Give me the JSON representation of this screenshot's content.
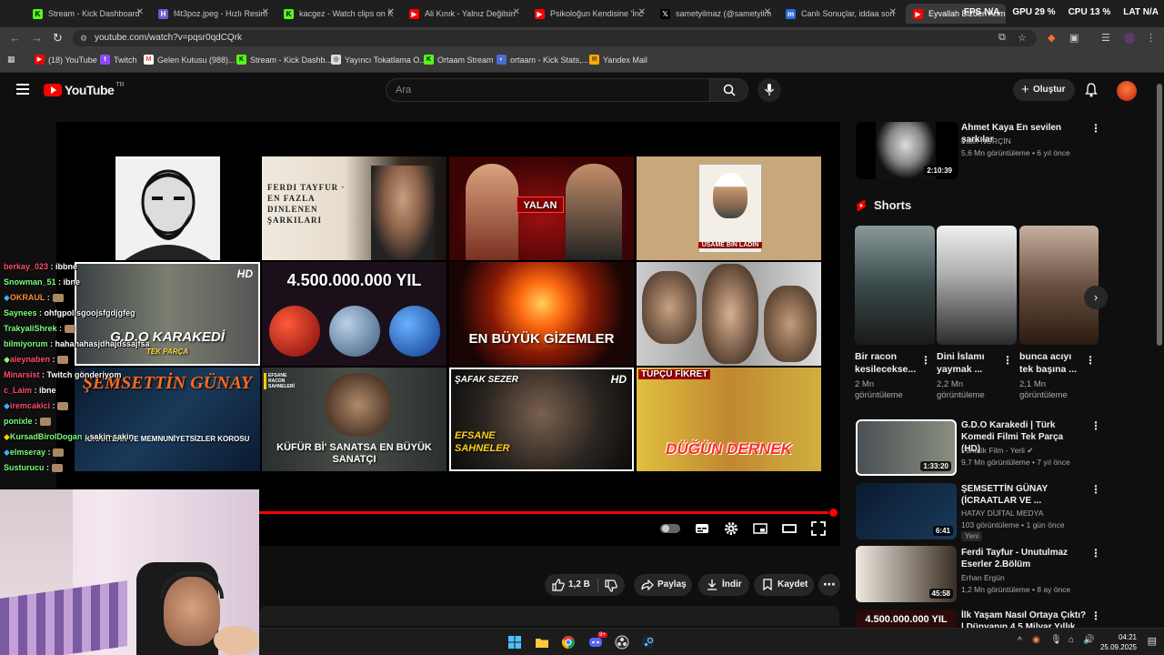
{
  "browser": {
    "tabs": [
      {
        "label": "Stream - Kick Dashboard",
        "color": "#53fc18"
      },
      {
        "label": "f4t3poz.jpeg - Hızlı Resim",
        "color": "#6b5bd2"
      },
      {
        "label": "kacgez - Watch clips on K",
        "color": "#53fc18"
      },
      {
        "label": "Ali Kınık - Yalnız Değilsin",
        "color": "#ff0000"
      },
      {
        "label": "Psikoloğun Kendisine 'İnc",
        "color": "#ff0000"
      },
      {
        "label": "sametyilmaz (@sametyilm",
        "color": "#ffffff"
      },
      {
        "label": "Canlı Sonuçlar, iddaa son",
        "color": "#2d6cdf"
      },
      {
        "label": "Eyvallah Bizden Ahm",
        "color": "#ff0000"
      }
    ],
    "perf": {
      "fps_label": "FPS",
      "fps": "N/A",
      "gpu_label": "GPU",
      "gpu": "29 %",
      "cpu_label": "CPU",
      "cpu": "13 %",
      "lat_label": "LAT",
      "lat": "N/A"
    },
    "url": "youtube.com/watch?v=pqsr0qdCQrk",
    "bookmarks": [
      {
        "label": "(18) YouTube",
        "color": "#ff0000"
      },
      {
        "label": "Twitch",
        "color": "#9146ff"
      },
      {
        "label": "Gelen Kutusu (988)...",
        "color": "#ea4335"
      },
      {
        "label": "Stream - Kick Dashb...",
        "color": "#53fc18"
      },
      {
        "label": "Yayıncı Tokatlama O...",
        "color": "#dddddd"
      },
      {
        "label": "Ortaam Stream",
        "color": "#53fc18"
      },
      {
        "label": "ortaam - Kick Stats,...",
        "color": "#4a6cd4"
      },
      {
        "label": "Yandex Mail",
        "color": "#ffaa00"
      }
    ]
  },
  "youtube": {
    "logo": "YouTube",
    "logo_country": "TR",
    "search_placeholder": "Ara",
    "create_label": "Oluştur",
    "accent": "#ff0000"
  },
  "player": {
    "end_screen": [
      {
        "id": "ahmet",
        "caption": ""
      },
      {
        "id": "ferdi",
        "caption": "FERDI TAYFUR · EN FAZLA DINLENEN ŞARKILARI"
      },
      {
        "id": "yalan",
        "caption": "YALAN"
      },
      {
        "id": "usame",
        "caption": "USAME BIN LADIN"
      },
      {
        "id": "gdo",
        "caption": "G.D.O KARAKEDİ",
        "sub": "TEK PARÇA",
        "hd": "HD"
      },
      {
        "id": "yil",
        "caption": "4.500.000.000 YIL"
      },
      {
        "id": "gizem",
        "caption": "EN BÜYÜK GİZEMLER"
      },
      {
        "id": "ferdi2",
        "caption": ""
      },
      {
        "id": "semsettin",
        "caption": "ŞEMSETTİN GÜNAY",
        "sub": "İCRAATLAR VE MEMNUNİYETSİZLER KOROSU"
      },
      {
        "id": "kufur",
        "caption": "KÜFÜR Bİ' SANATSA EN BÜYÜK SANATÇI",
        "badge": "EFSANE RACON SAHNELERİ"
      },
      {
        "id": "safak",
        "caption": "EFSANE SAHNELER",
        "top": "ŞAFAK SEZER",
        "hd": "HD"
      },
      {
        "id": "dugun",
        "caption": "DÜĞÜN DERNEK",
        "top": "TÜPÇÜ FİKRET"
      }
    ],
    "progress_played": 0.99
  },
  "actions": {
    "likes": "1,2 B",
    "share": "Paylaş",
    "download": "İndir",
    "save": "Kaydet"
  },
  "chat": [
    {
      "user": "berkay_023",
      "msg": "ibbne",
      "color": "#ff4d6d"
    },
    {
      "user": "Snowman_51",
      "msg": "ibne",
      "color": "#7dff7d"
    },
    {
      "user": "OKRAUL",
      "msg": "",
      "color": "#ff8c3a"
    },
    {
      "user": "Saynees",
      "msg": "ohfgpollsgoojsfgdjgfeg",
      "color": "#7dff7d"
    },
    {
      "user": "TrakyaliShrek",
      "msg": "",
      "color": "#7dff7d"
    },
    {
      "user": "bilmiyorum",
      "msg": "hahahahasjdhajdssajfsa",
      "color": "#7dff7d"
    },
    {
      "user": "aleynaben",
      "msg": "",
      "color": "#ff4d6d"
    },
    {
      "user": "Minarsist",
      "msg": "Twitch gönderiyom",
      "color": "#ff4d6d"
    },
    {
      "user": "c_Laim",
      "msg": "ibne",
      "color": "#ff4d6d"
    },
    {
      "user": "iremcakici",
      "msg": "",
      "color": "#ff4d6d"
    },
    {
      "user": "ponixle",
      "msg": "",
      "color": "#7dff7d"
    },
    {
      "user": "KursadBirolDogan",
      "msg": "sakin sakin",
      "color": "#7dff7d"
    },
    {
      "user": "elmseray",
      "msg": "",
      "color": "#7dff7d"
    },
    {
      "user": "Susturucu",
      "msg": "",
      "color": "#7dff7d"
    }
  ],
  "sidebar": {
    "top_video": {
      "title": "Ahmet Kaya En sevilen şarkılar",
      "channel": "Fatih NORÇİN",
      "meta": "5,6 Mn görüntüleme • 6 yıl önce",
      "duration": "2:10:39"
    },
    "shorts_heading": "Shorts",
    "shorts": [
      {
        "title": "Bir racon kesilecekse...",
        "views": "2 Mn görüntüleme"
      },
      {
        "title": "Dini İslamı yaymak ...",
        "views": "2,2 Mn görüntüleme"
      },
      {
        "title": "bunca acıyı tek başına ...",
        "views": "2,1 Mn görüntüleme"
      }
    ],
    "videos": [
      {
        "title": "G.D.O Karakedi | Türk Komedi Filmi Tek Parça (HD)",
        "channel": "Fanatik Film - Yerli",
        "meta": "9,7 Mn görüntüleme • 7 yıl önce",
        "duration": "1:33:20",
        "badge": ""
      },
      {
        "title": "ŞEMSETTİN GÜNAY (İCRAATLAR VE ...",
        "channel": "HATAY DİJİTAL MEDYA",
        "meta": "103 görüntüleme • 1 gün önce",
        "duration": "6:41",
        "badge": "Yeni"
      },
      {
        "title": "Ferdi Tayfur - Unutulmaz Eserler 2.Bölüm",
        "channel": "Erhan Ergün",
        "meta": "1,2 Mn görüntüleme • 8 ay önce",
        "duration": "45:58",
        "badge": ""
      },
      {
        "title": "İlk Yaşam Nasıl Ortaya Çıktı? | Dünyanın 4,5 Milyar Yıllık...",
        "channel": "",
        "meta": "",
        "duration": "",
        "badge": ""
      }
    ]
  },
  "taskbar": {
    "time": "04:21",
    "date": "25.09.2025"
  }
}
